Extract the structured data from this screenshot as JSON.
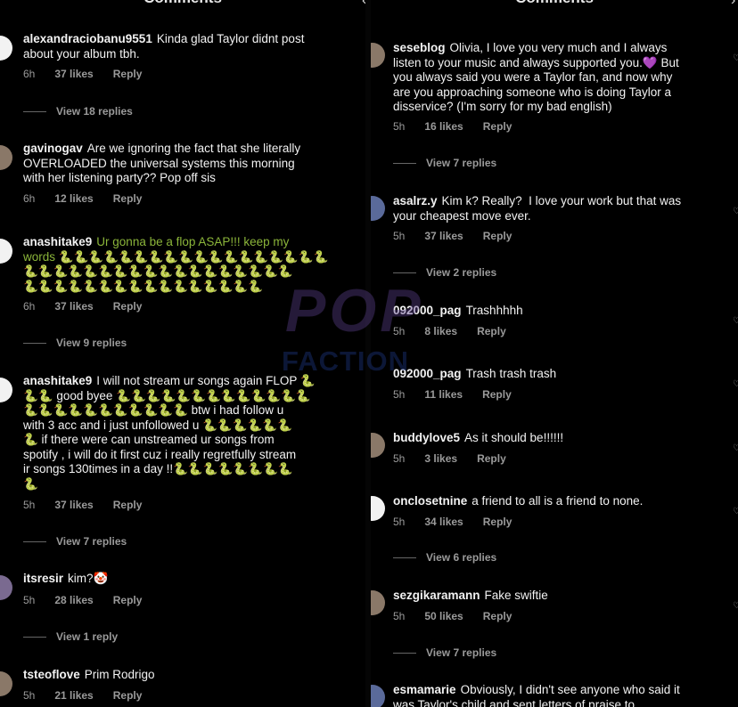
{
  "headers": {
    "left": "Comments",
    "right": "Comments"
  },
  "left": {
    "comments": [
      {
        "user": "alexandraciobanu9551",
        "text": "Kinda glad Taylor didnt post\nabout your album tbh.",
        "time": "6h",
        "likes": "37 likes",
        "reply": "Reply",
        "replies": "View 18 replies"
      },
      {
        "user": "gavinogav",
        "text": "Are we ignoring the fact that she literally\nOVERLOADED the universal systems this morning\nwith her listening party?? Pop off sis",
        "time": "6h",
        "likes": "12 likes",
        "reply": "Reply",
        "replies": ""
      },
      {
        "user": "anashitake9",
        "text": "Ur gonna be a flop ASAP!!! keep my\nwords 🐍🐍🐍🐍🐍🐍🐍🐍🐍🐍🐍🐍🐍🐍🐍🐍🐍🐍\n🐍🐍🐍🐍🐍🐍🐍🐍🐍🐍🐍🐍🐍🐍🐍🐍🐍🐍\n🐍🐍🐍🐍🐍🐍🐍🐍🐍🐍🐍🐍🐍🐍🐍🐍",
        "time": "6h",
        "likes": "37 likes",
        "reply": "Reply",
        "replies": "View 9 replies"
      },
      {
        "user": "anashitake9",
        "text": "I will not stream ur songs again FLOP 🐍\n🐍🐍 good byee 🐍🐍🐍🐍🐍🐍🐍🐍🐍🐍🐍🐍🐍\n🐍🐍🐍🐍🐍🐍🐍🐍🐍🐍🐍 btw i had follow u\nwith 3 acc and i just unfollowed u 🐍🐍🐍🐍🐍🐍\n🐍 if there were can unstreamed ur songs from\nspotify , i will do it first cuz i really regretfully stream\nir songs 130times in a day !!🐍🐍🐍🐍🐍🐍🐍🐍\n🐍",
        "time": "5h",
        "likes": "37 likes",
        "reply": "Reply",
        "replies": "View 7 replies"
      },
      {
        "user": "itsresir",
        "text": "kim?🤡",
        "time": "5h",
        "likes": "28 likes",
        "reply": "Reply",
        "replies": "View 1 reply"
      },
      {
        "user": "tsteoflove",
        "text": "Prim Rodrigo",
        "time": "5h",
        "likes": "21 likes",
        "reply": "Reply",
        "replies": ""
      }
    ]
  },
  "right": {
    "comments": [
      {
        "user": "seseblog",
        "text": "Olivia, I love you very much and I always\nlisten to your music and always supported you.💜 But\nyou always said you were a Taylor fan, and now why\nare you approaching someone who is doing Taylor a\ndisservice? (I'm sorry for my bad english)",
        "time": "5h",
        "likes": "16 likes",
        "reply": "Reply",
        "replies": "View 7 replies"
      },
      {
        "user": "asalrz.y",
        "text": "Kim k? Really?  I love your work but that was\nyour cheapest move ever.",
        "time": "5h",
        "likes": "37 likes",
        "reply": "Reply",
        "replies": "View 2 replies"
      },
      {
        "user": "092000_pag",
        "text": "Trashhhhh",
        "time": "5h",
        "likes": "8 likes",
        "reply": "Reply",
        "replies": ""
      },
      {
        "user": "092000_pag",
        "text": "Trash trash trash",
        "time": "5h",
        "likes": "11 likes",
        "reply": "Reply",
        "replies": ""
      },
      {
        "user": "buddylove5",
        "text": "As it should be!!!!!!",
        "time": "5h",
        "likes": "3 likes",
        "reply": "Reply",
        "replies": ""
      },
      {
        "user": "onclosetnine",
        "text": "a friend to all is a friend to none.",
        "time": "5h",
        "likes": "34 likes",
        "reply": "Reply",
        "replies": "View 6 replies"
      },
      {
        "user": "sezgikaramann",
        "text": "Fake swiftie",
        "time": "5h",
        "likes": "50 likes",
        "reply": "Reply",
        "replies": "View 7 replies"
      },
      {
        "user": "esmamarie",
        "text": "Obviously, I didn't see anyone who said it\nwas Taylor's child and sent letters of praise to",
        "time": "",
        "likes": "",
        "reply": "",
        "replies": ""
      }
    ]
  },
  "watermark": {
    "line1": "POP",
    "line2": "FACTION"
  },
  "icons": {
    "like": "heart-outline-icon"
  }
}
